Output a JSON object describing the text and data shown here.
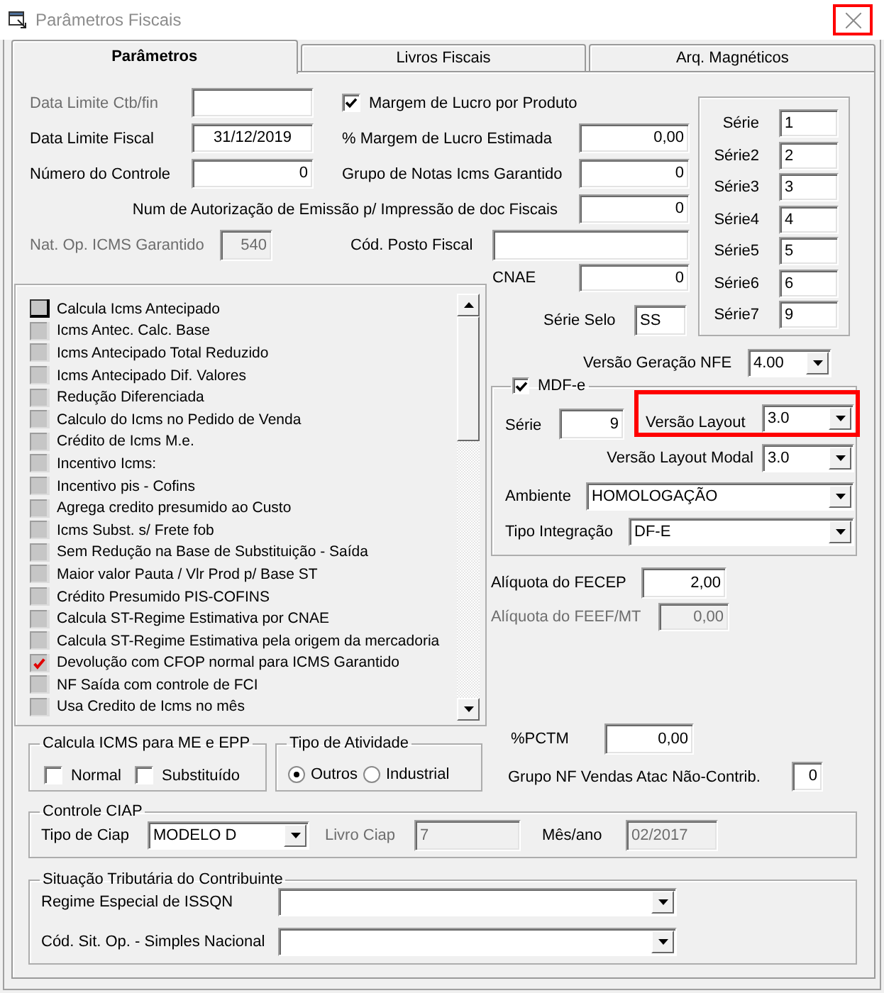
{
  "window": {
    "title": "Parâmetros Fiscais",
    "close_highlighted": true
  },
  "tabs": [
    {
      "label": "Parâmetros",
      "selected": true
    },
    {
      "label": "Livros Fiscais",
      "selected": false
    },
    {
      "label": "Arq. Magnéticos",
      "selected": false
    }
  ],
  "fields": {
    "data_limite_ctb_fin": {
      "label": "Data Limite Ctb/fin",
      "label_dimmed": true
    },
    "data_limite_fiscal": {
      "label": "Data Limite Fiscal",
      "value": "31/12/2019"
    },
    "numero_controle": {
      "label": "Número do Controle",
      "value": "0"
    },
    "margem_lucro_produto": {
      "label": "Margem de Lucro por Produto",
      "checked": true
    },
    "margem_lucro_estimada": {
      "label": "% Margem de Lucro Estimada",
      "value": "0,00"
    },
    "grupo_notas_icms_garantido": {
      "label": "Grupo de Notas Icms Garantido",
      "value": "0"
    },
    "num_autorizacao": {
      "label": "Num de Autorização de Emissão p/ Impressão de doc Fiscais",
      "value": "0"
    },
    "nat_op_icms_garantido": {
      "label": "Nat. Op. ICMS Garantido",
      "value": "540",
      "label_dimmed": true,
      "disabled": true
    },
    "cod_posto_fiscal": {
      "label": "Cód. Posto Fiscal"
    },
    "cnae": {
      "label": "CNAE",
      "value": "0"
    },
    "serie_selo": {
      "label": "Série Selo",
      "value": "SS"
    }
  },
  "series": [
    {
      "label": "Série",
      "value": "1"
    },
    {
      "label": "Série2",
      "value": "2"
    },
    {
      "label": "Série3",
      "value": "3"
    },
    {
      "label": "Série4",
      "value": "4"
    },
    {
      "label": "Série5",
      "value": "5"
    },
    {
      "label": "Série6",
      "value": "6"
    },
    {
      "label": "Série7",
      "value": "9"
    }
  ],
  "versao_geracao_nfe": {
    "label": "Versão Geração NFE",
    "value": "4.00"
  },
  "mdfe": {
    "label": "MDF-e",
    "checked": true,
    "serie": {
      "label": "Série",
      "value": "9"
    },
    "versao_layout": {
      "label": "Versão Layout",
      "value": "3.0",
      "highlighted": true
    },
    "versao_layout_modal": {
      "label": "Versão Layout Modal",
      "value": "3.0"
    },
    "ambiente": {
      "label": "Ambiente",
      "value": "HOMOLOGAÇÃO"
    },
    "tipo_integracao": {
      "label": "Tipo Integração",
      "value": "DF-E"
    }
  },
  "aliquotas": {
    "fecep": {
      "label": "Alíquota do FECEP",
      "value": "2,00"
    },
    "feef_mt": {
      "label": "Alíquota do FEEF/MT",
      "value": "0,00",
      "label_dimmed": true,
      "disabled": true
    }
  },
  "pctm": {
    "label": "%PCTM",
    "value": "0,00"
  },
  "grupo_nf_vendas_atac": {
    "label": "Grupo NF Vendas Atac Não-Contrib.",
    "value": "0"
  },
  "options_list": [
    {
      "label": "Calcula Icms Antecipado",
      "checked": false,
      "focused": true
    },
    {
      "label": "Icms Antec. Calc. Base",
      "checked": false,
      "focused": false
    },
    {
      "label": "Icms Antecipado Total Reduzido",
      "checked": false,
      "focused": false
    },
    {
      "label": "Icms Antecipado Dif. Valores",
      "checked": false,
      "focused": false
    },
    {
      "label": "Redução Diferenciada",
      "checked": false,
      "focused": false
    },
    {
      "label": "Calculo do Icms no Pedido de Venda",
      "checked": false,
      "focused": false
    },
    {
      "label": "Crédito de Icms M.e.",
      "checked": false,
      "focused": false
    },
    {
      "label": "Incentivo Icms:",
      "checked": false,
      "focused": false
    },
    {
      "label": "Incentivo pis - Cofins",
      "checked": false,
      "focused": false
    },
    {
      "label": "Agrega credito presumido ao Custo",
      "checked": false,
      "focused": false
    },
    {
      "label": "Icms Subst. s/ Frete fob",
      "checked": false,
      "focused": false
    },
    {
      "label": "Sem Redução na Base de Substituição - Saída",
      "checked": false,
      "focused": false
    },
    {
      "label": "Maior valor Pauta / Vlr Prod p/ Base ST",
      "checked": false,
      "focused": false
    },
    {
      "label": "Crédito Presumido PIS-COFINS",
      "checked": false,
      "focused": false
    },
    {
      "label": "Calcula ST-Regime Estimativa por CNAE",
      "checked": false,
      "focused": false
    },
    {
      "label": "Calcula ST-Regime Estimativa pela origem da mercadoria",
      "checked": false,
      "focused": false
    },
    {
      "label": "Devolução com CFOP normal para ICMS Garantido",
      "checked": true,
      "focused": false
    },
    {
      "label": "NF Saída com controle de FCI",
      "checked": false,
      "focused": false
    },
    {
      "label": "Usa Credito de Icms no mês",
      "checked": false,
      "focused": false
    }
  ],
  "calcula_icms_me_epp": {
    "title": "Calcula ICMS para ME e EPP",
    "options": [
      {
        "label": "Normal",
        "checked": false
      },
      {
        "label": "Substituído",
        "checked": false
      }
    ]
  },
  "tipo_atividade": {
    "title": "Tipo de Atividade",
    "options": [
      {
        "label": "Outros",
        "selected": true
      },
      {
        "label": "Industrial",
        "selected": false
      }
    ]
  },
  "controle_ciap": {
    "title": "Controle CIAP",
    "tipo_ciap": {
      "label": "Tipo de Ciap",
      "value": "MODELO D"
    },
    "livro_ciap": {
      "label": "Livro Ciap",
      "value": "7",
      "label_dimmed": true,
      "disabled": true
    },
    "mes_ano": {
      "label": "Mês/ano",
      "value": "02/2017",
      "disabled": true
    }
  },
  "situacao_tributaria": {
    "title": "Situação Tributária do Contribuinte",
    "regime_especial_issqn": {
      "label": "Regime Especial de ISSQN"
    },
    "cod_sit_op_simples": {
      "label": "Cód. Sit. Op. - Simples Nacional"
    }
  }
}
